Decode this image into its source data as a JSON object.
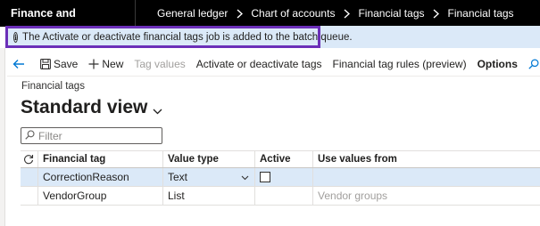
{
  "topbar": {
    "app_title": "Finance and Operations",
    "breadcrumbs": [
      "General ledger",
      "Chart of accounts",
      "Financial tags",
      "Financial tags"
    ]
  },
  "message": {
    "text": "The Activate or deactivate financial tags job is added to the batch queue."
  },
  "actions": {
    "save": "Save",
    "new": "New",
    "tag_values": "Tag values",
    "activate": "Activate or deactivate tags",
    "rules": "Financial tag rules (preview)",
    "options": "Options"
  },
  "page": {
    "caption": "Financial tags",
    "view_title": "Standard view"
  },
  "filter": {
    "placeholder": "Filter"
  },
  "grid": {
    "headers": [
      "Financial tag",
      "Value type",
      "Active",
      "Use values from"
    ],
    "rows": [
      {
        "tag": "CorrectionReason",
        "value_type": "Text",
        "active": false,
        "use_values_from": ""
      },
      {
        "tag": "VendorGroup",
        "value_type": "List",
        "active": null,
        "use_values_from": "Vendor groups"
      }
    ]
  },
  "colors": {
    "topbar_bg": "#000000",
    "message_bg": "#dbe9f8",
    "highlight_border": "#6b2fb8",
    "selected_row_bg": "#dbe9f8",
    "accent": "#0078d4"
  }
}
